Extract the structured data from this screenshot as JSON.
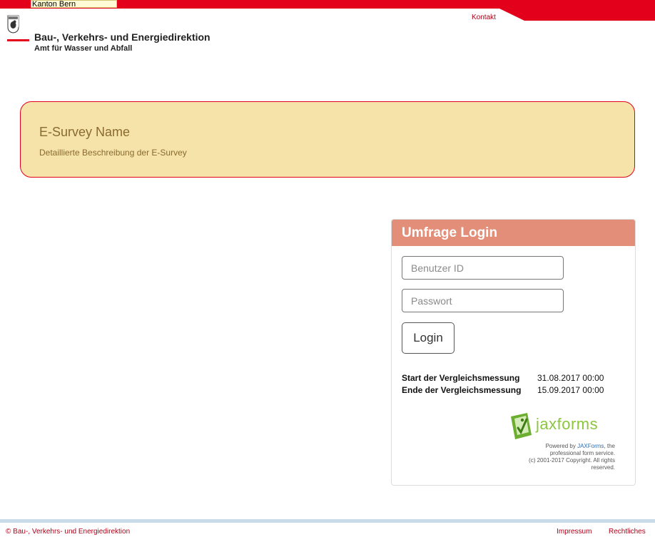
{
  "top": {
    "kanton_label": "Kanton Bern",
    "kontakt_link": "Kontakt"
  },
  "header": {
    "title": "Bau-, Verkehrs- und Energiedirektion",
    "subtitle": "Amt für Wasser und Abfall"
  },
  "survey": {
    "name": "E-Survey Name",
    "description": "Detaillierte Beschreibung der E-Survey"
  },
  "login": {
    "heading": "Umfrage Login",
    "user_placeholder": "Benutzer ID",
    "password_placeholder": "Passwort",
    "button_label": "Login",
    "start_label": "Start der Vergleichsmessung",
    "start_value": "31.08.2017 00:00",
    "end_label": "Ende der Vergleichsmessung",
    "end_value": "15.09.2017 00:00"
  },
  "jaxforms": {
    "logo_text": "jaxforms",
    "powered_prefix": "Powered by",
    "powered_link": "JAXForms",
    "powered_suffix": ", the professional form service.",
    "copyright": "(c) 2001-2017 Copyright. All rights reserved."
  },
  "footer": {
    "copyright": "© Bau-, Verkehrs- und Energiedirektion",
    "impressum": "Impressum",
    "rechtliches": "Rechtliches"
  },
  "colors": {
    "brand_red": "#e2001a",
    "banner_bg": "#f5e3aa",
    "banner_text": "#8a6a2e",
    "panel_header": "#e28e78",
    "jax_green": "#8cc63f"
  }
}
